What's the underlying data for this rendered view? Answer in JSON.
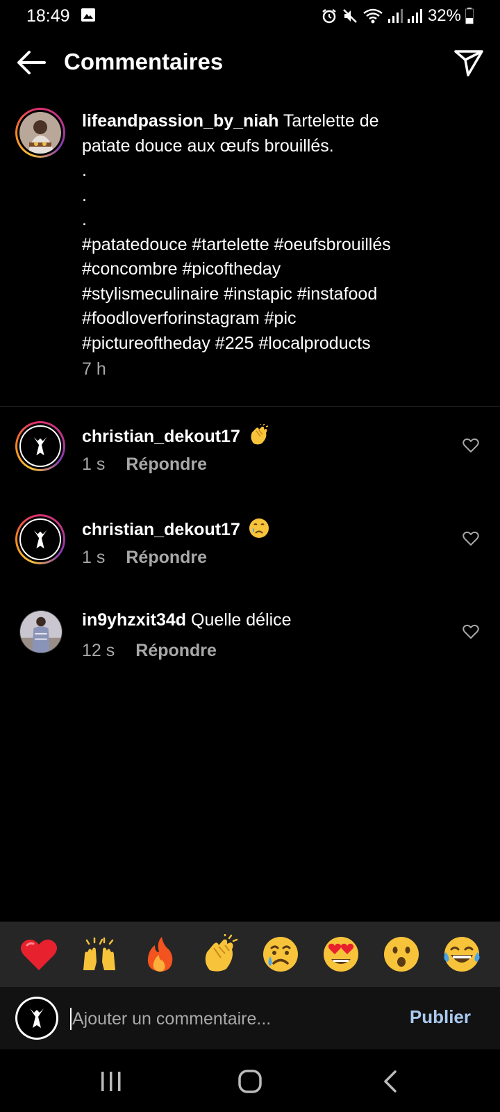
{
  "status_bar": {
    "time": "18:49",
    "battery": "32%"
  },
  "header": {
    "title": "Commentaires"
  },
  "caption": {
    "username": "lifeandpassion_by_niah",
    "first_text": " Tartelette de",
    "lines": [
      "patate douce aux œufs brouillés.",
      ".",
      ".",
      ".",
      "#patatedouce #tartelette #oeufsbrouillés",
      "#concombre #picoftheday",
      "#stylismeculinaire #instapic #instafood",
      "#foodloverforinstagram #pic",
      "#pictureoftheday #225 #localproducts"
    ],
    "time": "7 h"
  },
  "comments": [
    {
      "username": "christian_dekout17",
      "text": "",
      "emoji": "clapping-hands",
      "time": "1 s",
      "reply": "Répondre"
    },
    {
      "username": "christian_dekout17",
      "text": "",
      "emoji": "crying-face",
      "time": "1 s",
      "reply": "Répondre"
    },
    {
      "username": "in9yhzxit34d",
      "text": " Quelle délice",
      "emoji": "",
      "time": "12 s",
      "reply": "Répondre"
    }
  ],
  "emoji_bar": [
    "red-heart",
    "raising-hands",
    "fire",
    "clapping-hands",
    "crying-face",
    "heart-eyes",
    "surprised-face",
    "tears-of-joy"
  ],
  "input": {
    "placeholder": "Ajouter un commentaire...",
    "publish": "Publier"
  },
  "colors": {
    "background": "#000000",
    "secondary_text": "#a8a8a8",
    "publish": "#a9c9ef",
    "emoji_bar_bg": "#262626"
  }
}
